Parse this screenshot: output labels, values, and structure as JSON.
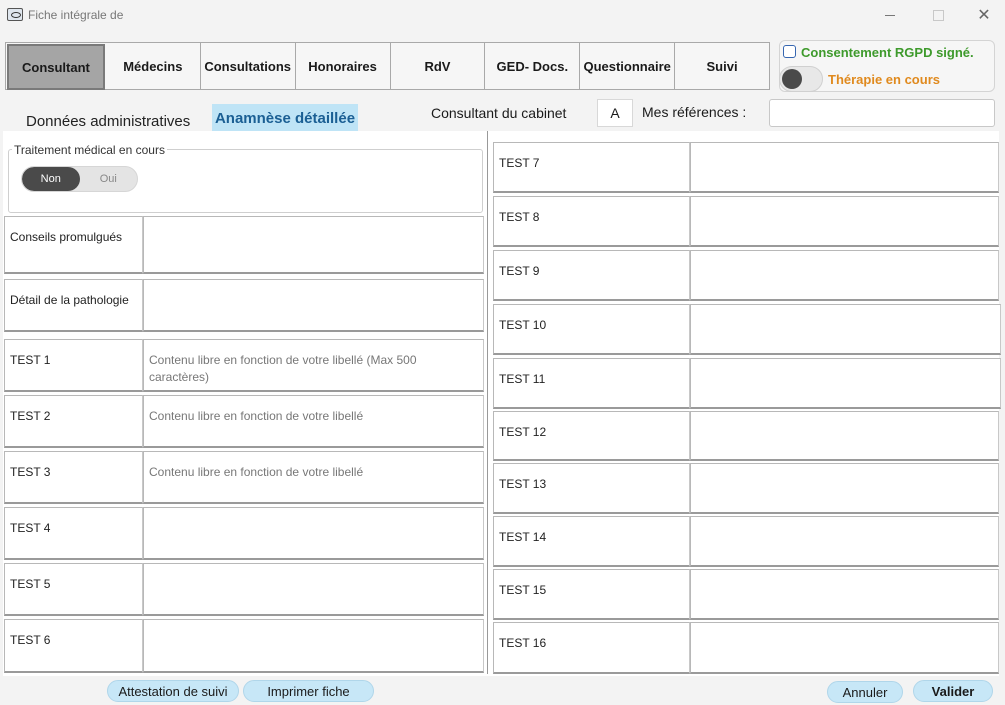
{
  "window": {
    "title": "Fiche intégrale de",
    "close_glyph": "✕"
  },
  "tabs": [
    {
      "label": "Consultant",
      "active": true
    },
    {
      "label": "Médecins"
    },
    {
      "label": "Consultations"
    },
    {
      "label": "Honoraires"
    },
    {
      "label": "RdV"
    },
    {
      "label": "GED- Docs."
    },
    {
      "label": "Questionnaire"
    },
    {
      "label": "Suivi"
    }
  ],
  "consent": {
    "rgpd_label": "Consentement RGPD signé.",
    "rgpd_checked": false,
    "rgpd_color": "#3e9a2c",
    "therapie_label": "Thérapie en cours",
    "therapie_on": false,
    "therapie_color": "#e08a1e"
  },
  "subtabs": {
    "admin": "Données administratives",
    "anamnese": "Anamnèse détaillée",
    "active": "anamnese"
  },
  "cabinet": {
    "label": "Consultant du cabinet",
    "value": "A"
  },
  "references": {
    "label": "Mes références :",
    "value": ""
  },
  "traitement": {
    "title": "Traitement médical en cours",
    "options": [
      "Non",
      "Oui"
    ],
    "selected": "Non"
  },
  "left_rows": [
    {
      "label": "Conseils promulgués",
      "value": ""
    },
    {
      "label": "Détail de la pathologie",
      "value": ""
    },
    {
      "label": "TEST 1",
      "value": "Contenu libre en fonction de votre libellé (Max 500 caractères)"
    },
    {
      "label": "TEST 2",
      "value": "Contenu libre en fonction de votre libellé"
    },
    {
      "label": "TEST 3",
      "value": "Contenu libre en fonction de votre libellé"
    },
    {
      "label": "TEST 4",
      "value": ""
    },
    {
      "label": "TEST 5",
      "value": ""
    },
    {
      "label": "TEST 6",
      "value": ""
    }
  ],
  "right_rows": [
    {
      "label": "TEST 7",
      "value": ""
    },
    {
      "label": "TEST 8",
      "value": ""
    },
    {
      "label": "TEST 9",
      "value": ""
    },
    {
      "label": "TEST 10",
      "value": ""
    },
    {
      "label": "TEST 11",
      "value": ""
    },
    {
      "label": "TEST 12",
      "value": ""
    },
    {
      "label": "TEST 13",
      "value": ""
    },
    {
      "label": "TEST 14",
      "value": ""
    },
    {
      "label": "TEST 15",
      "value": ""
    },
    {
      "label": "TEST 16",
      "value": ""
    }
  ],
  "footer": {
    "attestation": "Attestation de suivi",
    "imprimer": "Imprimer fiche",
    "annuler": "Annuler",
    "valider": "Valider"
  }
}
